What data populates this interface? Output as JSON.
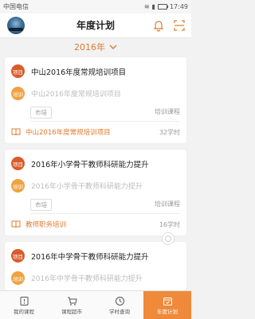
{
  "status_bar": {
    "carrier": "中国电信",
    "time": "17:49"
  },
  "header": {
    "title": "年度计划"
  },
  "year_selector": {
    "label": "2016年"
  },
  "badges": {
    "project": "项目",
    "training": "培训"
  },
  "cards": [
    {
      "project_name": "中山2016年度常规培训项目",
      "training_name": "中山2016年度常规培训项目",
      "tag": "市培",
      "type": "培训课程",
      "bottom_text": "中山2016年度常规培训项目",
      "hours": "32学时"
    },
    {
      "project_name": "2016年小学骨干教师科研能力提升",
      "training_name": "2016年小学骨干教师科研能力提升",
      "tag": "市培",
      "type": "培训课程",
      "bottom_text": "教师职务培训",
      "hours": "16学时"
    },
    {
      "project_name": "2016年中学骨干教师科研能力提升",
      "training_name": "2016年中学骨干教师科研能力提升"
    }
  ],
  "tabs": [
    {
      "label": "我的课程",
      "icon": "my-course-icon"
    },
    {
      "label": "课程超市",
      "icon": "cart-icon"
    },
    {
      "label": "学时查询",
      "icon": "clock-icon"
    },
    {
      "label": "年度计划",
      "icon": "calendar-icon",
      "active": true
    }
  ],
  "colors": {
    "accent": "#ef8a3a",
    "project_badge": "#d95c2b",
    "training_badge": "#f0a140"
  }
}
